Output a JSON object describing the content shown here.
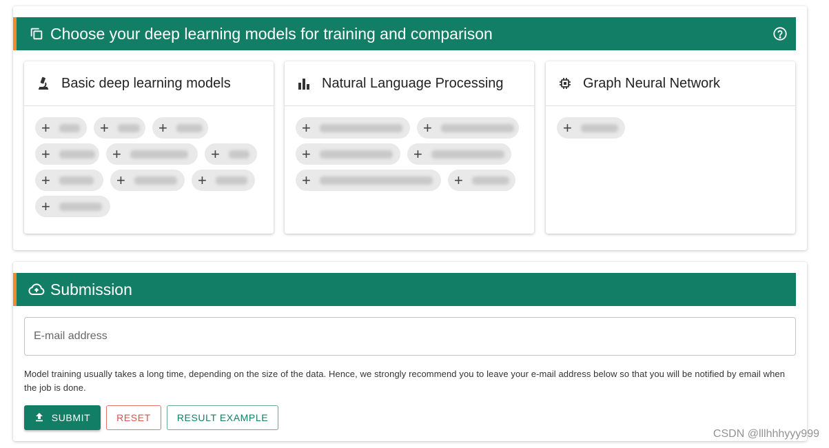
{
  "models_section": {
    "title": "Choose your deep learning models for training and comparison",
    "header_icon": "library-copy-icon",
    "help_icon": "help-circle-icon",
    "accent_color": "#ef8a2e",
    "header_color": "#127e66",
    "cards": [
      {
        "title": "Basic deep learning models",
        "icon": "microscope-icon",
        "chips": [
          {
            "label": "",
            "blurred": true
          },
          {
            "label": "",
            "blurred": true
          },
          {
            "label": "",
            "blurred": true
          },
          {
            "label": "",
            "blurred": true
          },
          {
            "label": "",
            "blurred": true
          },
          {
            "label": "",
            "blurred": true
          },
          {
            "label": "",
            "blurred": true
          },
          {
            "label": "",
            "blurred": true
          },
          {
            "label": "",
            "blurred": true
          },
          {
            "label": "",
            "blurred": true
          }
        ]
      },
      {
        "title": "Natural Language Processing",
        "icon": "bar-chart-icon",
        "chips": [
          {
            "label": "",
            "blurred": true
          },
          {
            "label": "",
            "blurred": true
          },
          {
            "label": "",
            "blurred": true
          },
          {
            "label": "",
            "blurred": true
          },
          {
            "label": "",
            "blurred": true
          },
          {
            "label": "",
            "blurred": true
          }
        ]
      },
      {
        "title": "Graph Neural Network",
        "icon": "chip-icon",
        "chips": [
          {
            "label": "",
            "blurred": true
          }
        ]
      }
    ]
  },
  "submission_section": {
    "title": "Submission",
    "header_icon": "cloud-upload-icon",
    "email": {
      "placeholder": "E-mail address",
      "value": ""
    },
    "hint": "Model training usually takes a long time, depending on the size of the data. Hence, we strongly recommend you to leave your e-mail address below so that you will be notified by email when the job is done.",
    "buttons": {
      "submit": "SUBMIT",
      "reset": "RESET",
      "example": "RESULT EXAMPLE"
    }
  },
  "watermark": "CSDN @lllhhhyyy999"
}
